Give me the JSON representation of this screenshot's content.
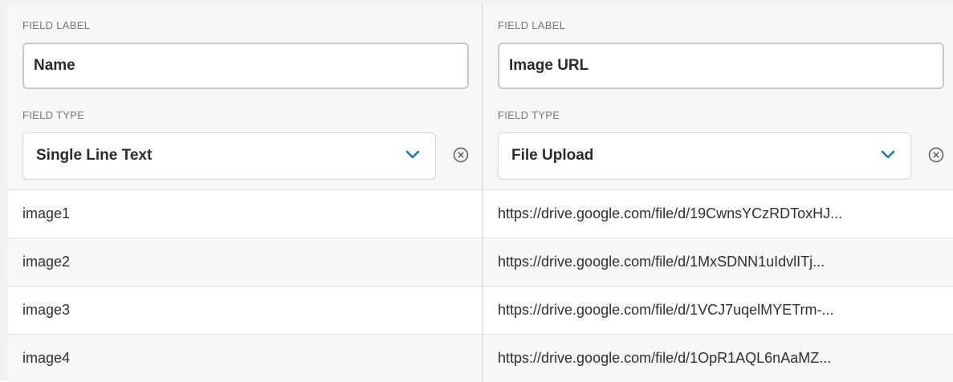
{
  "columns": [
    {
      "field_label_caption": "FIELD LABEL",
      "field_label_value": "Name",
      "field_type_caption": "FIELD TYPE",
      "field_type_value": "Single Line Text"
    },
    {
      "field_label_caption": "FIELD LABEL",
      "field_label_value": "Image URL",
      "field_type_caption": "FIELD TYPE",
      "field_type_value": "File Upload"
    }
  ],
  "rows": [
    {
      "name": "image1",
      "url": "https://drive.google.com/file/d/19CwnsYCzRDToxHJ..."
    },
    {
      "name": "image2",
      "url": "https://drive.google.com/file/d/1MxSDNN1uIdvlITj..."
    },
    {
      "name": "image3",
      "url": "https://drive.google.com/file/d/1VCJ7uqelMYETrm-..."
    },
    {
      "name": "image4",
      "url": "https://drive.google.com/file/d/1OpR1AQL6nAaMZ..."
    }
  ],
  "icons": {
    "dropdown": "chevron-down-icon",
    "remove": "circle-x-icon"
  },
  "colors": {
    "chevron": "#1f78b4",
    "header_bg": "#f7f7f7",
    "alt_row_bg": "#f7f7f7"
  }
}
